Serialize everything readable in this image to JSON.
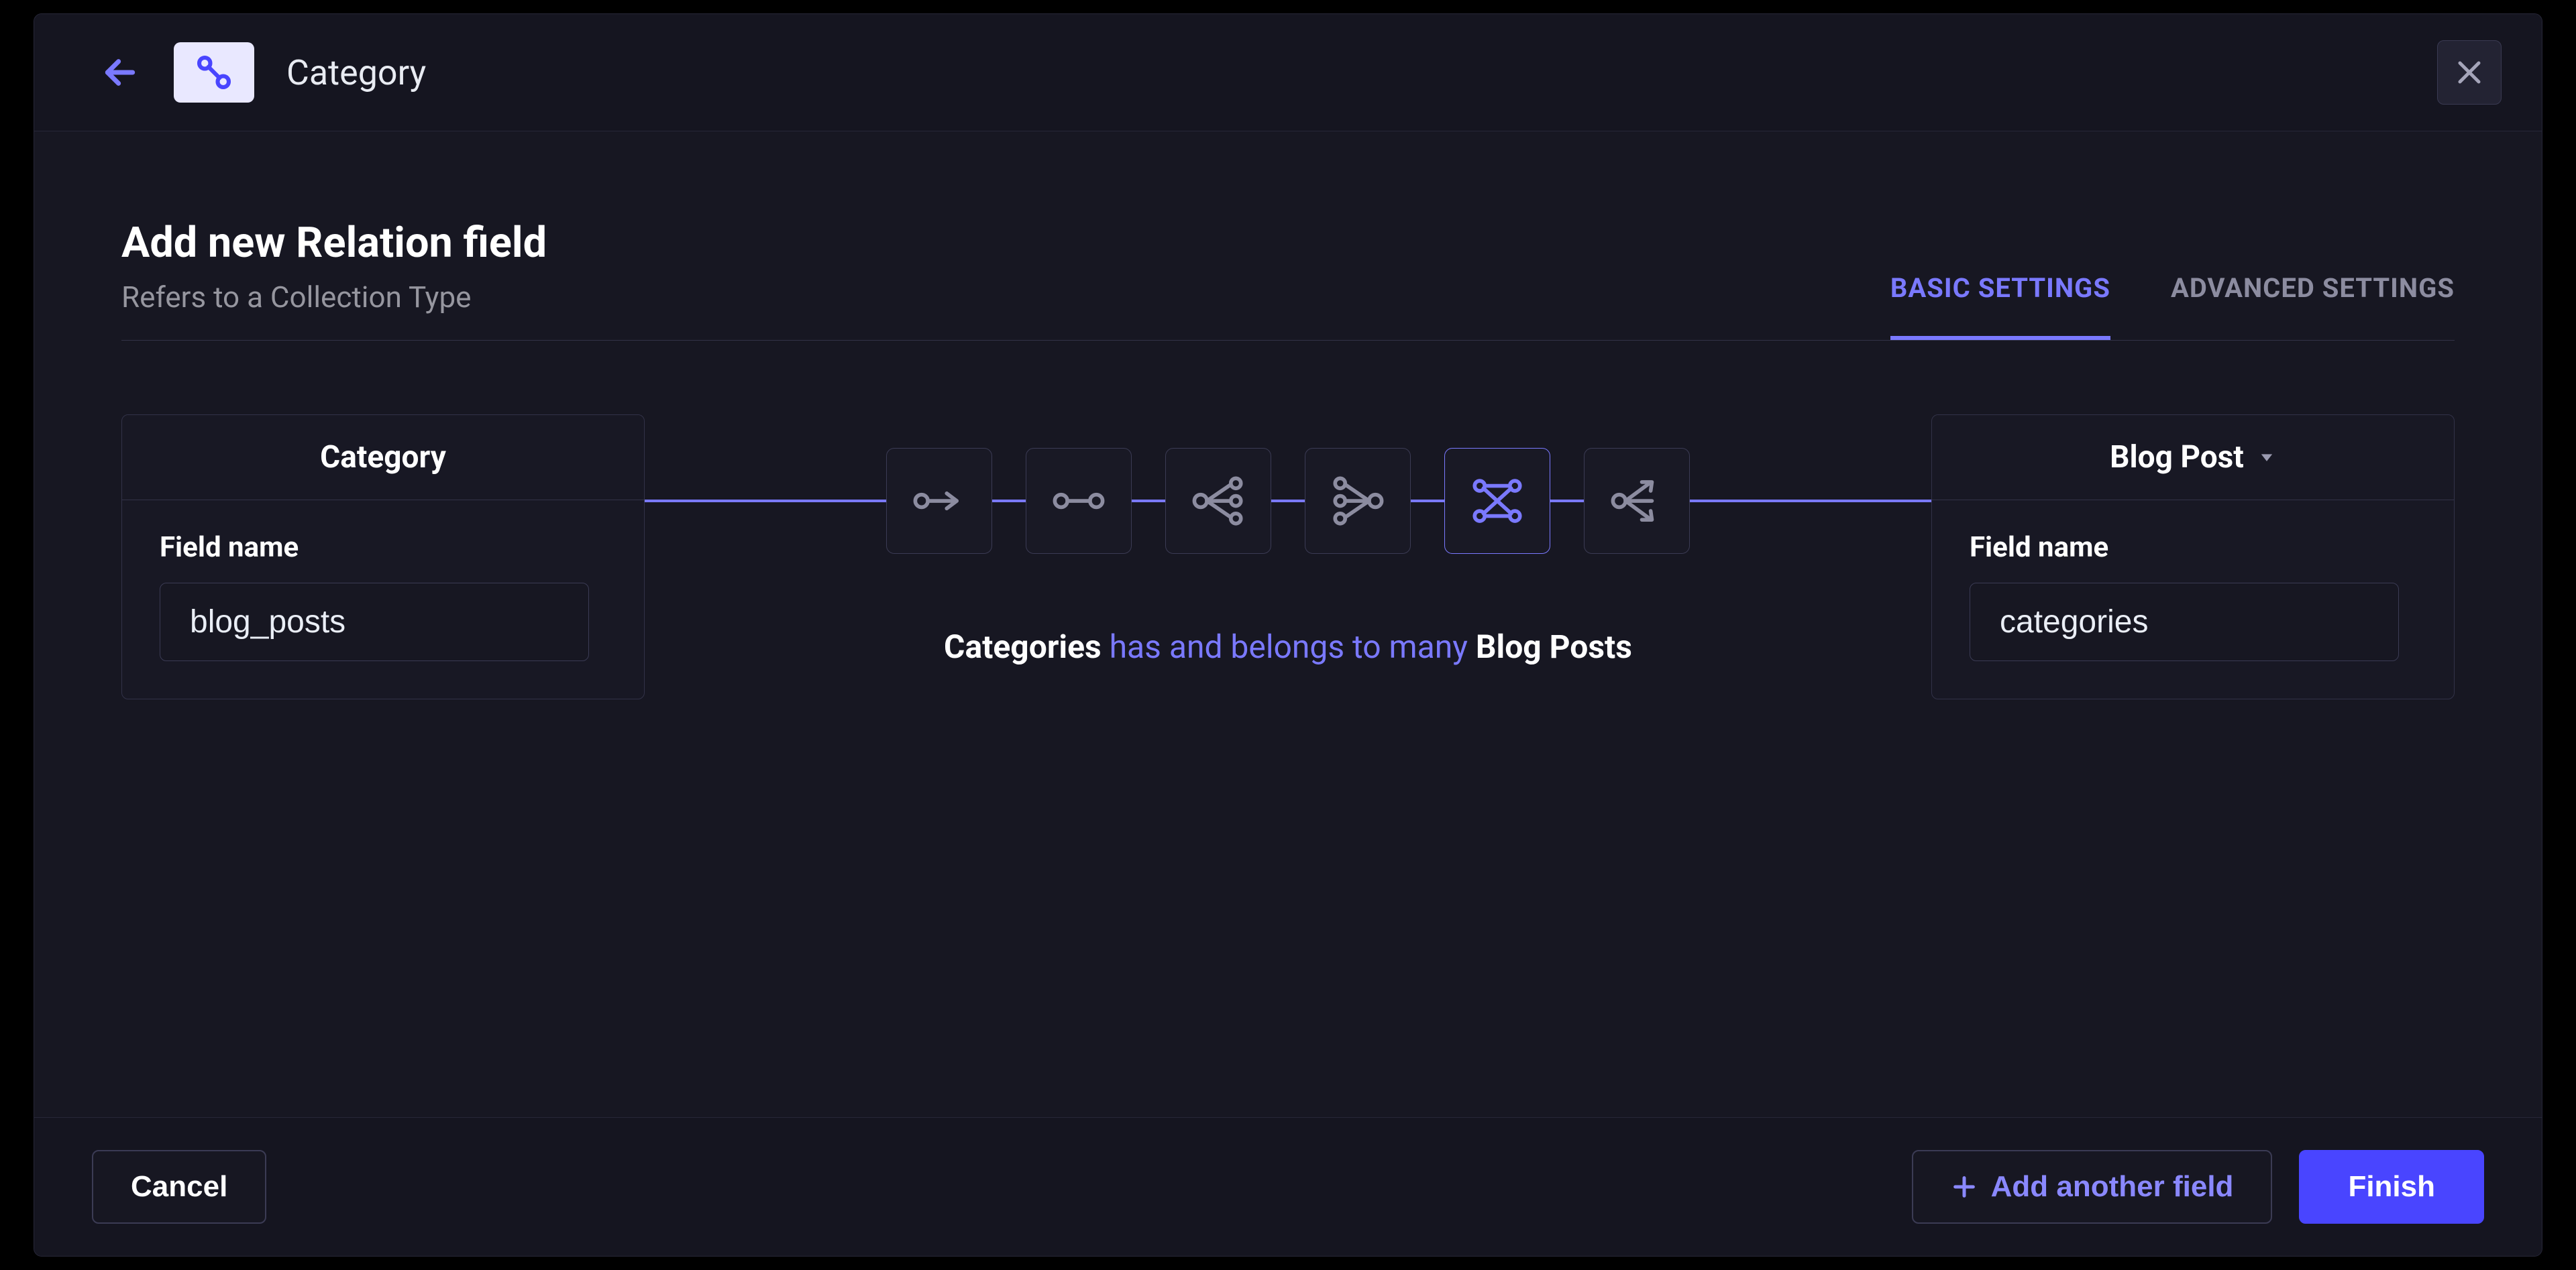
{
  "header": {
    "type_name": "Category"
  },
  "page": {
    "title": "Add new Relation field",
    "subtitle": "Refers to a Collection Type"
  },
  "tabs": {
    "basic": "BASIC SETTINGS",
    "advanced": "ADVANCED SETTINGS"
  },
  "left_card": {
    "title": "Category",
    "field_label": "Field name",
    "field_value": "blog_posts"
  },
  "right_card": {
    "title": "Blog Post",
    "field_label": "Field name",
    "field_value": "categories"
  },
  "relation_sentence": {
    "subject": "Categories",
    "phrase": "has and belongs to many",
    "object": "Blog Posts"
  },
  "footer": {
    "cancel": "Cancel",
    "add_another": "Add another field",
    "finish": "Finish"
  }
}
